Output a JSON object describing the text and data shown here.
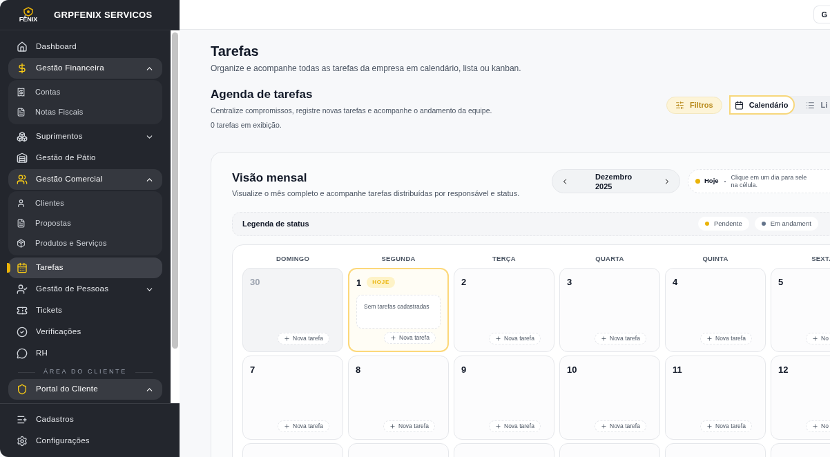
{
  "sidebar": {
    "logo_text": "FÊNIX",
    "company": "GRPFENIX SERVICOS",
    "items": [
      {
        "label": "Dashboard",
        "selected": false
      },
      {
        "label": "Gestão Financeira",
        "kind": "group",
        "selected": false,
        "expanded": true,
        "children": [
          {
            "label": "Contas"
          },
          {
            "label": "Notas Fiscais"
          }
        ]
      },
      {
        "label": "Suprimentos",
        "kind": "group",
        "selected": false,
        "expanded": false
      },
      {
        "label": "Gestão de Pátio",
        "selected": false
      },
      {
        "label": "Gestão Comercial",
        "kind": "group",
        "selected": false,
        "expanded": true,
        "children": [
          {
            "label": "Clientes"
          },
          {
            "label": "Propostas"
          },
          {
            "label": "Produtos e Serviços"
          }
        ]
      },
      {
        "label": "Tarefas",
        "selected": true
      },
      {
        "label": "Gestão de Pessoas",
        "kind": "group",
        "selected": false,
        "expanded": false
      },
      {
        "label": "Tickets",
        "selected": false
      },
      {
        "label": "Verificações",
        "selected": false
      },
      {
        "label": "RH",
        "selected": false
      }
    ],
    "section_label": "ÁREA DO CLIENTE",
    "portal": {
      "label": "Portal do Cliente",
      "expanded": true
    },
    "footer": [
      {
        "label": "Cadastros"
      },
      {
        "label": "Configurações"
      }
    ]
  },
  "header": {
    "button": "G"
  },
  "page": {
    "title": "Tarefas",
    "subtitle": "Organize e acompanhe todas as tarefas da empresa em calendário, lista ou kanban."
  },
  "agenda": {
    "title": "Agenda de tarefas",
    "description": "Centralize compromissos, registre novas tarefas e acompanhe o andamento da equipe.",
    "count": "0 tarefas em exibição.",
    "filters": "Filtros",
    "views": [
      {
        "label": "Calendário",
        "selected": true
      },
      {
        "label": "Li",
        "selected": false
      }
    ]
  },
  "monthly": {
    "title": "Visão mensal",
    "description": "Visualize o mês completo e acompanhe tarefas distribuídas por responsável e status.",
    "month": "Dezembro",
    "year": "2025",
    "today_label": "Hoje",
    "hint": "Clique em um dia para sele",
    "hint_line2": "na célula.",
    "legend_title": "Legenda de status",
    "legend": [
      {
        "label": "Pendente",
        "color": "#eab308"
      },
      {
        "label": "Em andament",
        "color": "#64748b"
      }
    ],
    "weekdays": [
      "DOMINGO",
      "SEGUNDA",
      "TERÇA",
      "QUARTA",
      "QUINTA",
      "SEXT."
    ],
    "weeks": [
      [
        {
          "number": "30",
          "outside": true,
          "today": false,
          "add": "Nova tarefa"
        },
        {
          "number": "1",
          "outside": false,
          "today": true,
          "badge": "HOJE",
          "empty_text": "Sem tarefas cadastradas",
          "add": "Nova tarefa"
        },
        {
          "number": "2",
          "outside": false,
          "today": false,
          "add": "Nova tarefa"
        },
        {
          "number": "3",
          "outside": false,
          "today": false,
          "add": "Nova tarefa"
        },
        {
          "number": "4",
          "outside": false,
          "today": false,
          "add": "Nova tarefa"
        },
        {
          "number": "5",
          "outside": false,
          "today": false,
          "add": "No"
        }
      ],
      [
        {
          "number": "7",
          "outside": false,
          "today": false,
          "add": "Nova tarefa"
        },
        {
          "number": "8",
          "outside": false,
          "today": false,
          "add": "Nova tarefa"
        },
        {
          "number": "9",
          "outside": false,
          "today": false,
          "add": "Nova tarefa"
        },
        {
          "number": "10",
          "outside": false,
          "today": false,
          "add": "Nova tarefa"
        },
        {
          "number": "11",
          "outside": false,
          "today": false,
          "add": "Nova tarefa"
        },
        {
          "number": "12",
          "outside": false,
          "today": false,
          "add": "No"
        }
      ]
    ]
  }
}
